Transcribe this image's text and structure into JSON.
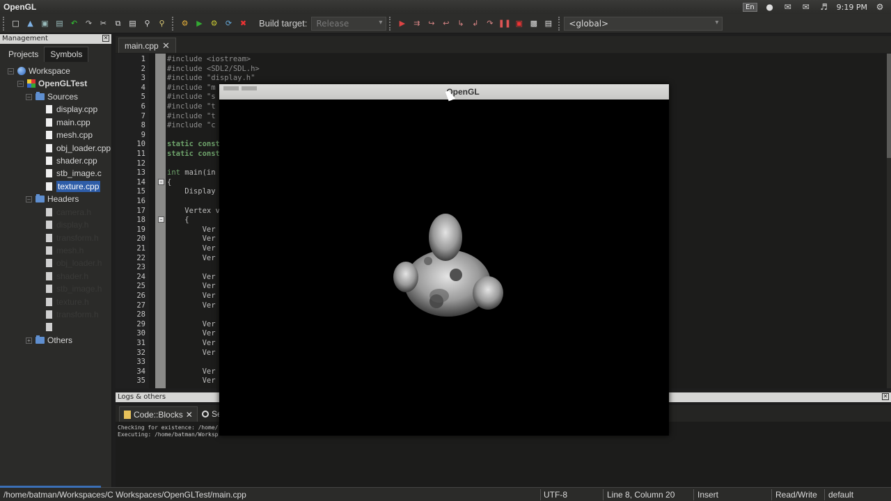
{
  "app": {
    "title": "OpenGL"
  },
  "tray": {
    "lang": "En",
    "clock": "9:19 PM"
  },
  "toolbar": {
    "build_target_label": "Build target:",
    "build_target_value": "Release",
    "scope_value": "<global>"
  },
  "management": {
    "header": "Management",
    "tabs": [
      "Projects",
      "Symbols"
    ],
    "workspace": "Workspace",
    "project": "OpenGLTest",
    "sources_folder": "Sources",
    "sources": [
      "display.cpp",
      "main.cpp",
      "mesh.cpp",
      "obj_loader.cpp",
      "shader.cpp",
      "stb_image.c",
      "texture.cpp"
    ],
    "headers_folder": "Headers",
    "headers": [
      "camera.h",
      "display.h",
      "transform.h",
      "mesh.h",
      "obj_loader.h",
      "shader.h",
      "stb_image.h",
      "texture.h",
      "transform.h",
      ""
    ],
    "others_folder": "Others"
  },
  "editor": {
    "tab_label": "main.cpp",
    "code_lines": [
      [
        {
          "t": "#include <iostream>",
          "c": "pp"
        }
      ],
      [
        {
          "t": "#include <SDL2/SDL.h>",
          "c": "pp"
        }
      ],
      [
        {
          "t": "#include \"display.h\"",
          "c": "pp"
        }
      ],
      [
        {
          "t": "#include \"m",
          "c": "pp"
        }
      ],
      [
        {
          "t": "#include \"s",
          "c": "pp"
        }
      ],
      [
        {
          "t": "#include \"t",
          "c": "pp"
        }
      ],
      [
        {
          "t": "#include \"t",
          "c": "pp"
        }
      ],
      [
        {
          "t": "#include \"c",
          "c": "pp"
        }
      ],
      [],
      [
        {
          "t": "static const",
          "c": "kw"
        }
      ],
      [
        {
          "t": "static const",
          "c": "kw"
        }
      ],
      [],
      [
        {
          "t": "int",
          "c": "ty"
        },
        {
          "t": " main(in",
          "c": "tx"
        }
      ],
      [
        {
          "t": "{",
          "c": "tx"
        }
      ],
      [
        {
          "t": "    Display",
          "c": "tx"
        }
      ],
      [],
      [
        {
          "t": "    Vertex v",
          "c": "tx"
        }
      ],
      [
        {
          "t": "    {",
          "c": "tx"
        }
      ],
      [
        {
          "t": "        Ver",
          "c": "tx"
        }
      ],
      [
        {
          "t": "        Ver",
          "c": "tx"
        }
      ],
      [
        {
          "t": "        Ver",
          "c": "tx"
        }
      ],
      [
        {
          "t": "        Ver",
          "c": "tx"
        }
      ],
      [],
      [
        {
          "t": "        Ver",
          "c": "tx"
        }
      ],
      [
        {
          "t": "        Ver",
          "c": "tx"
        }
      ],
      [
        {
          "t": "        Ver",
          "c": "tx"
        }
      ],
      [
        {
          "t": "        Ver",
          "c": "tx"
        }
      ],
      [],
      [
        {
          "t": "        Ver",
          "c": "tx"
        }
      ],
      [
        {
          "t": "        Ver",
          "c": "tx"
        }
      ],
      [
        {
          "t": "        Ver",
          "c": "tx"
        }
      ],
      [
        {
          "t": "        Ver",
          "c": "tx"
        }
      ],
      [],
      [
        {
          "t": "        Ver",
          "c": "tx"
        }
      ],
      [
        {
          "t": "        Ver",
          "c": "tx"
        }
      ]
    ]
  },
  "logs": {
    "header": "Logs & others",
    "tab_codeblocks": "Code::Blocks",
    "tab_search": "Se",
    "lines": [
      "Checking for existence: /home/",
      "Executing: /home/batman/Worksp"
    ]
  },
  "gl_window": {
    "title": "OpenGL"
  },
  "status": {
    "path": "/home/batman/Workspaces/C Workspaces/OpenGLTest/main.cpp",
    "encoding": "UTF-8",
    "position": "Line 8, Column 20",
    "mode": "Insert",
    "access": "Read/Write",
    "profile": "default"
  }
}
